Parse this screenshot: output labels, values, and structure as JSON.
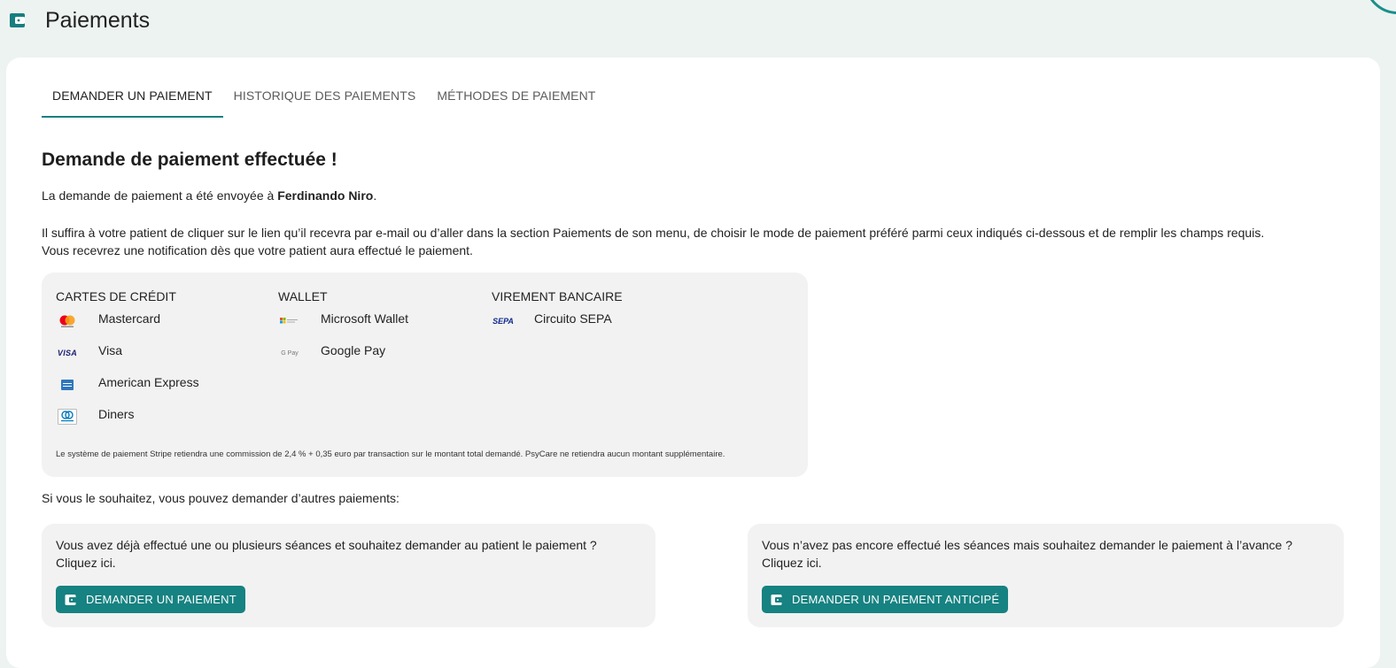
{
  "header": {
    "title": "Paiements"
  },
  "tabs": [
    {
      "label": "DEMANDER UN PAIEMENT"
    },
    {
      "label": "HISTORIQUE DES PAIEMENTS"
    },
    {
      "label": "MÉTHODES DE PAIEMENT"
    }
  ],
  "result": {
    "title": "Demande de paiement effectuée !",
    "sent_prefix": "La demande de paiement a été envoyée à ",
    "patient_name": "Ferdinando Niro",
    "sent_suffix": ".",
    "instructions_line1": "Il suffira à votre patient de cliquer sur le lien qu’il recevra par e-mail ou d’aller dans la section Paiements de son menu, de choisir le mode de paiement préféré parmi ceux indiqués ci-dessous et de remplir les champs requis.",
    "instructions_line2": "Vous recevrez une notification dès que votre patient aura effectué le paiement."
  },
  "methods": {
    "cards": {
      "header": "CARTES DE CRÉDIT",
      "items": [
        {
          "label": "Mastercard",
          "icon": "mastercard-icon"
        },
        {
          "label": "Visa",
          "icon": "visa-icon",
          "logo_text": "VISA"
        },
        {
          "label": "American Express",
          "icon": "amex-icon"
        },
        {
          "label": "Diners",
          "icon": "diners-icon"
        }
      ]
    },
    "wallet": {
      "header": "WALLET",
      "items": [
        {
          "label": "Microsoft Wallet",
          "icon": "microsoft-wallet-icon"
        },
        {
          "label": "Google Pay",
          "icon": "google-pay-icon",
          "logo_text": "G Pay"
        }
      ]
    },
    "bank": {
      "header": "VIREMENT BANCAIRE",
      "items": [
        {
          "label": "Circuito SEPA",
          "icon": "sepa-icon",
          "logo_text": "SEPA"
        }
      ]
    },
    "fee_note": "Le système de paiement Stripe retiendra une commission de 2,4 % + 0,35 euro par transaction sur le montant total demandé. PsyCare ne retiendra aucun montant supplémentaire."
  },
  "other_payments_text": "Si vous le souhaitez, vous pouvez demander d’autres paiements:",
  "box_past": {
    "line1": "Vous avez déjà effectué une ou plusieurs séances et souhaitez demander au patient le paiement ?",
    "line2": "Cliquez ici.",
    "button": "DEMANDER UN PAIEMENT"
  },
  "box_advance": {
    "line1": "Vous n’avez pas encore effectué les séances mais souhaitez demander le paiement à l’avance ?",
    "line2": "Cliquez ici.",
    "button": "DEMANDER UN PAIEMENT ANTICIPÉ"
  },
  "colors": {
    "accent": "#168281",
    "panel": "#f2f2f2",
    "background": "#edf3f1"
  }
}
